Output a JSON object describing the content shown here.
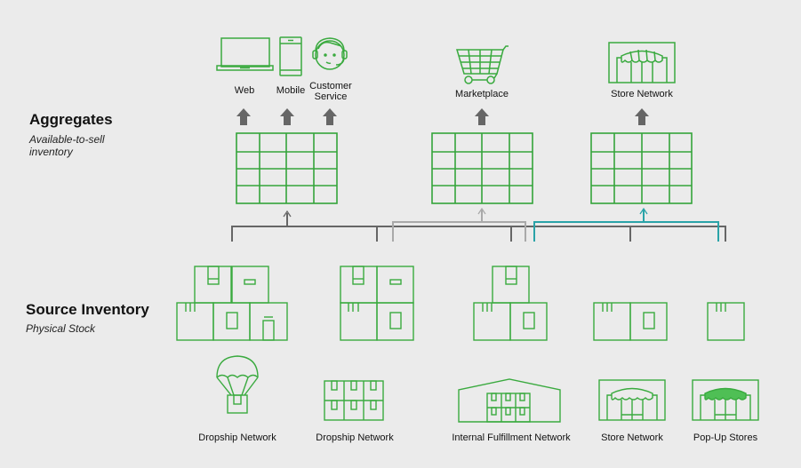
{
  "sections": {
    "aggregates": {
      "title": "Aggregates",
      "subtitle_line1": "Available-to-sell",
      "subtitle_line2": "inventory"
    },
    "source": {
      "title": "Source Inventory",
      "subtitle": "Physical Stock"
    }
  },
  "channels": [
    {
      "label": "Web",
      "icon": "laptop-icon"
    },
    {
      "label": "Mobile",
      "icon": "mobile-phone-icon"
    },
    {
      "label_line1": "Customer",
      "label_line2": "Service",
      "icon": "headset-agent-icon"
    },
    {
      "label": "Marketplace",
      "icon": "shopping-cart-icon"
    },
    {
      "label": "Store Network",
      "icon": "storefront-icon"
    }
  ],
  "sources": [
    {
      "label": "Dropship Network",
      "icon": "parachute-box-icon"
    },
    {
      "label": "Dropship Network",
      "icon": "box-grid-icon"
    },
    {
      "label": "Internal Fulfillment Network",
      "icon": "warehouse-icon"
    },
    {
      "label": "Store Network",
      "icon": "storefront-icon"
    },
    {
      "label": "Pop-Up Stores",
      "icon": "popup-store-icon"
    }
  ],
  "colors": {
    "background": "#ebebeb",
    "green": "#3aaa3f",
    "dark_connector": "#666666",
    "light_connector": "#a9a9a9",
    "teal_connector": "#2aa3a8"
  }
}
